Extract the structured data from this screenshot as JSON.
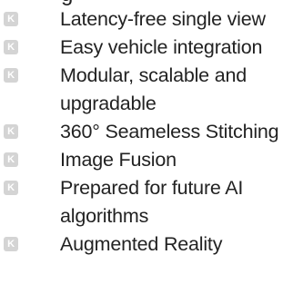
{
  "partial_heading_fragment": "g",
  "bullet_glyph": "K",
  "features": [
    "Latency-free single view",
    "Easy vehicle integration",
    "Modular, scalable and upgradable",
    "360° Seameless Stitching",
    "Image Fusion",
    "Prepared for future AI algorithms",
    "Augmented Reality"
  ]
}
